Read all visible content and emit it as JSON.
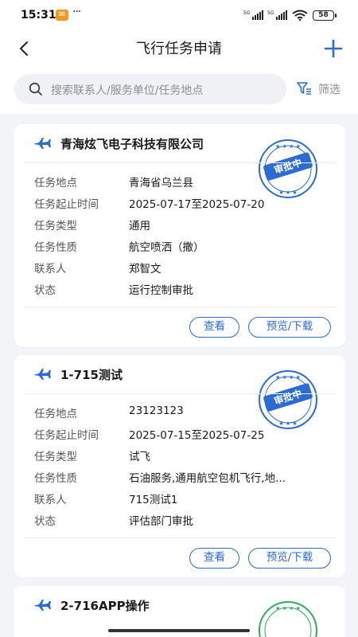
{
  "status_bar": {
    "time": "15:31",
    "dots": "···",
    "battery": "58",
    "signal": "5G"
  },
  "nav": {
    "title": "飞行任务申请"
  },
  "search": {
    "placeholder": "搜索联系人/服务单位/任务地点"
  },
  "filter": {
    "label": "筛选"
  },
  "colors": {
    "accent": "#2b6bd6",
    "stamp_pending": "#2b6bd6",
    "stamp_approved": "#2fae5a"
  },
  "cards": [
    {
      "title": "青海炫飞电子科技有限公司",
      "stamp": "审批中",
      "fields": [
        {
          "label": "任务地点",
          "value": "青海省乌兰县"
        },
        {
          "label": "任务起止时间",
          "value": "2025-07-17至2025-07-20"
        },
        {
          "label": "任务类型",
          "value": "通用"
        },
        {
          "label": "任务性质",
          "value": "航空喷洒（撒）"
        },
        {
          "label": "联系人",
          "value": "郑智文"
        },
        {
          "label": "状态",
          "value": "运行控制审批"
        }
      ],
      "buttons": {
        "view": "查看",
        "preview": "预览/下载"
      }
    },
    {
      "title": "1-715测试",
      "stamp": "审批中",
      "fields": [
        {
          "label": "任务地点",
          "value": "23123123"
        },
        {
          "label": "任务起止时间",
          "value": "2025-07-15至2025-07-25"
        },
        {
          "label": "任务类型",
          "value": "试飞"
        },
        {
          "label": "任务性质",
          "value": "石油服务,通用航空包机飞行,地..."
        },
        {
          "label": "联系人",
          "value": "715测试1"
        },
        {
          "label": "状态",
          "value": "评估部门审批"
        }
      ],
      "buttons": {
        "view": "查看",
        "preview": "预览/下载"
      }
    },
    {
      "title": "2-716APP操作"
    }
  ]
}
